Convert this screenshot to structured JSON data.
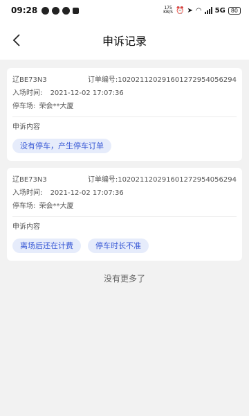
{
  "status_bar": {
    "time": "09:28",
    "speed": "175 KB/S",
    "network": "5G",
    "battery": "80"
  },
  "header": {
    "title": "申诉记录"
  },
  "records": [
    {
      "plate": "辽BE73N3",
      "order_label": "订单编号:",
      "order_no": "102021120291601272954056294",
      "entry_label": "入场时间:",
      "entry_time": "2021-12-02 17:07:36",
      "lot_label": "停车场:",
      "lot_name": "荣会**大厦",
      "appeal_label": "申诉内容",
      "tags": [
        "没有停车，产生停车订单"
      ]
    },
    {
      "plate": "辽BE73N3",
      "order_label": "订单编号:",
      "order_no": "102021120291601272954056294",
      "entry_label": "入场时间:",
      "entry_time": "2021-12-02 17:07:36",
      "lot_label": "停车场:",
      "lot_name": "荣会**大厦",
      "appeal_label": "申诉内容",
      "tags": [
        "离场后还在计费",
        "停车时长不准"
      ]
    }
  ],
  "footer": {
    "no_more": "没有更多了"
  },
  "colors": {
    "accent": "#3a5ad6",
    "tag_bg": "#e6ecfb",
    "page_bg": "#f2f2f2"
  }
}
